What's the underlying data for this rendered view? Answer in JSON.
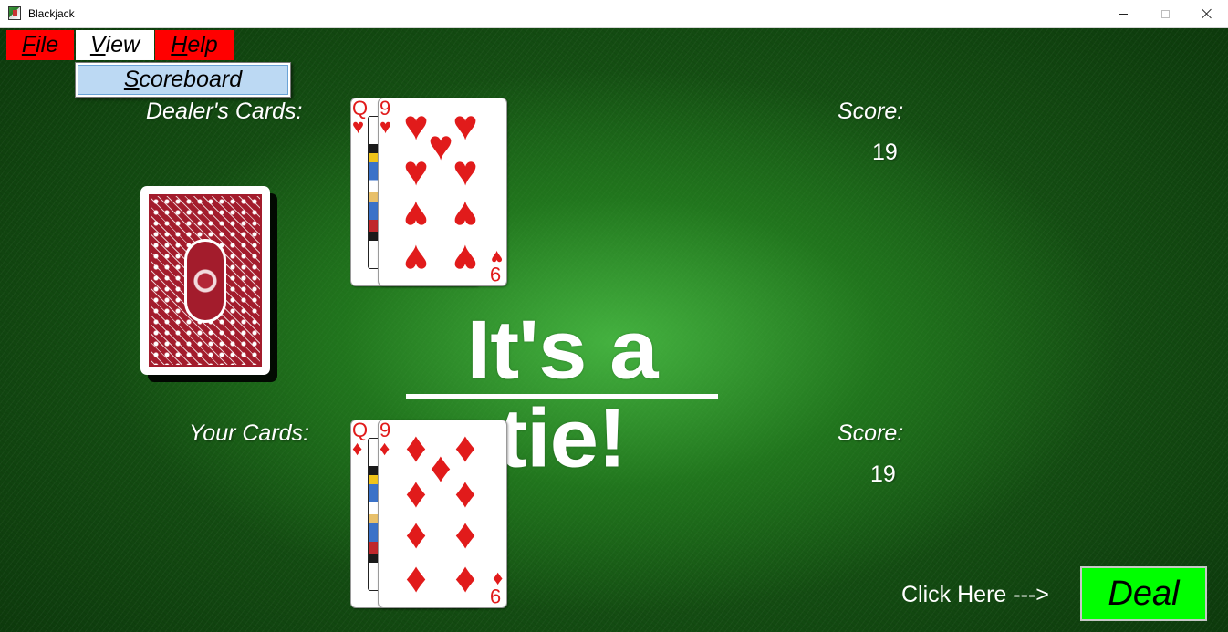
{
  "window": {
    "title": "Blackjack"
  },
  "menu": {
    "file": {
      "accel": "F",
      "rest": "ile"
    },
    "view": {
      "accel": "V",
      "rest": "iew"
    },
    "help": {
      "accel": "H",
      "rest": "elp"
    },
    "view_dropdown": {
      "scoreboard": {
        "accel": "S",
        "rest": "coreboard"
      }
    }
  },
  "dealer": {
    "label": "Dealer's Cards:",
    "score_label": "Score:",
    "score": "19",
    "cards": [
      {
        "rank": "Q",
        "suit": "♥",
        "suit_name": "hearts"
      },
      {
        "rank": "9",
        "suit": "♥",
        "suit_name": "hearts"
      }
    ]
  },
  "player": {
    "label": "Your Cards:",
    "score_label": "Score:",
    "score": "19",
    "cards": [
      {
        "rank": "Q",
        "suit": "♦",
        "suit_name": "diamonds"
      },
      {
        "rank": "9",
        "suit": "♦",
        "suit_name": "diamonds"
      }
    ]
  },
  "result": {
    "text": "It's a tie!"
  },
  "deal": {
    "hint": "Click Here --->",
    "button_label": "Deal"
  },
  "colors": {
    "menu_red": "#ff0000",
    "deal_green": "#00ff00",
    "card_red": "#e11b1b",
    "card_back_red": "#a31c2c",
    "dropdown_highlight": "#bcd9f3"
  }
}
